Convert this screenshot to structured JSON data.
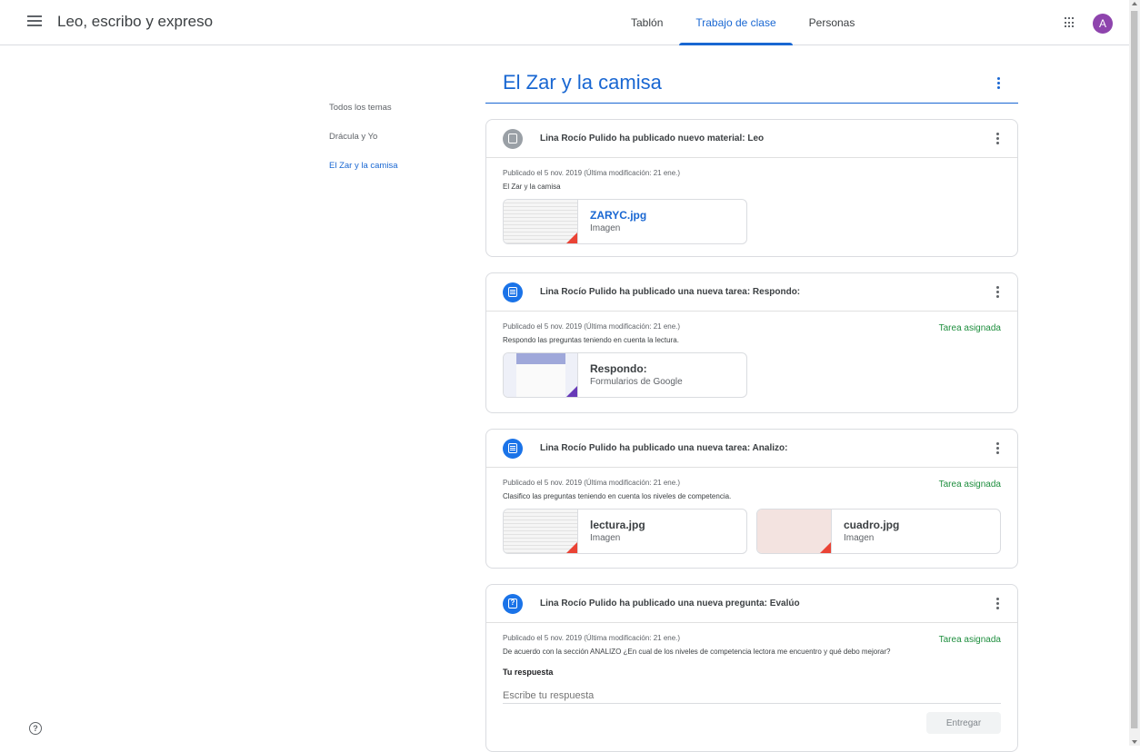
{
  "header": {
    "class_name": "Leo, escribo y expreso",
    "tabs": [
      {
        "label": "Tablón"
      },
      {
        "label": "Trabajo de clase"
      },
      {
        "label": "Personas"
      }
    ],
    "avatar_letter": "A"
  },
  "sidebar": {
    "items": [
      {
        "label": "Todos los temas"
      },
      {
        "label": "Drácula y Yo"
      },
      {
        "label": "El Zar y la camisa"
      }
    ]
  },
  "topic": {
    "title": "El Zar y la camisa"
  },
  "cards": [
    {
      "icon": "material-icon",
      "title": "Lina Rocío Pulido ha publicado nuevo material: Leo",
      "meta": "Publicado el 5 nov. 2019 (Última modificación: 21 ene.)",
      "status": "",
      "description": "El Zar y la camisa",
      "attachments": [
        {
          "name": "ZARYC.jpg",
          "type": "Imagen"
        }
      ]
    },
    {
      "icon": "assignment-icon",
      "title": "Lina Rocío Pulido ha publicado una nueva tarea: Respondo:",
      "meta": "Publicado el 5 nov. 2019 (Última modificación: 21 ene.)",
      "status": "Tarea asignada",
      "description": "Respondo las preguntas teniendo en cuenta la lectura.",
      "attachments": [
        {
          "name": "Respondo:",
          "type": "Formularios de Google"
        }
      ]
    },
    {
      "icon": "assignment-icon",
      "title": "Lina Rocío Pulido ha publicado una nueva tarea: Analizo:",
      "meta": "Publicado el 5 nov. 2019 (Última modificación: 21 ene.)",
      "status": "Tarea asignada",
      "description": "Clasifico las preguntas teniendo en cuenta los niveles de competencia.",
      "attachments": [
        {
          "name": "lectura.jpg",
          "type": "Imagen"
        },
        {
          "name": "cuadro.jpg",
          "type": "Imagen"
        }
      ]
    },
    {
      "icon": "question-icon",
      "title": "Lina Rocío Pulido ha publicado una nueva pregunta: Evalúo",
      "meta": "Publicado el 5 nov. 2019 (Última modificación: 21 ene.)",
      "status": "Tarea asignada",
      "description": "De acuerdo con la sección ANALIZO ¿En cual de los niveles de competencia lectora me encuentro y qué debo mejorar?",
      "answer_label": "Tu respuesta",
      "answer_placeholder": "Escribe tu respuesta",
      "submit_label": "Entregar"
    }
  ]
}
